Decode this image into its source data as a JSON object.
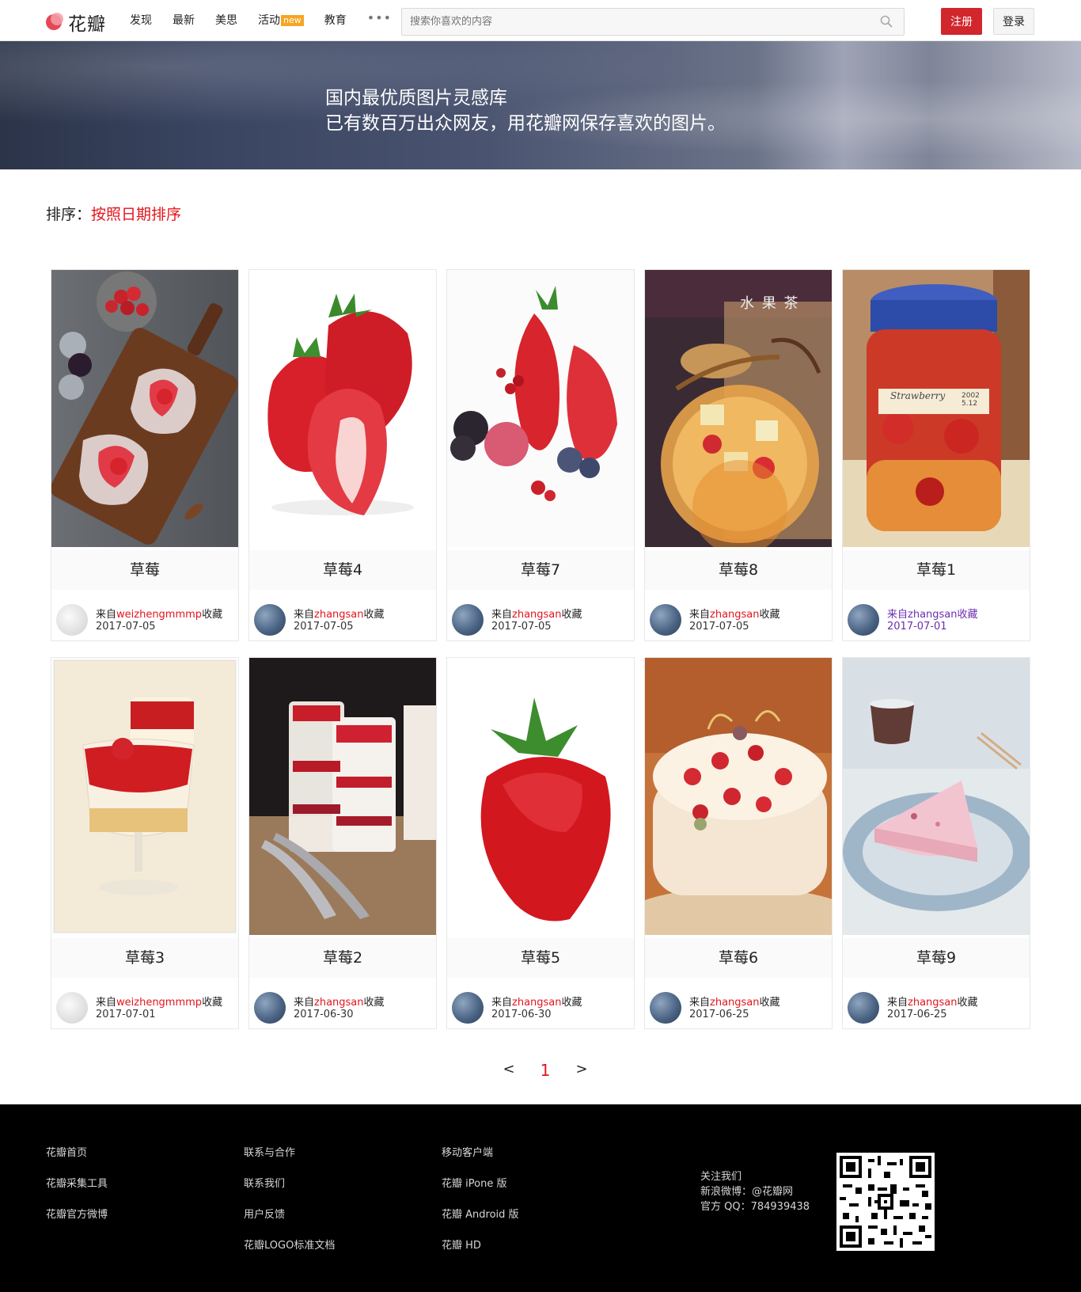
{
  "header": {
    "logo_text": "花瓣",
    "nav": [
      {
        "label": "发现"
      },
      {
        "label": "最新"
      },
      {
        "label": "美思"
      },
      {
        "label": "活动",
        "badge": "new"
      },
      {
        "label": "教育"
      }
    ],
    "more": "•••",
    "search_placeholder": "搜索你喜欢的内容",
    "register": "注册",
    "login": "登录",
    "brand_color": "#d1262c"
  },
  "banner": {
    "line1": "国内最优质图片灵感库",
    "line2": "已有数百万出众网友，用花瓣网保存喜欢的图片。"
  },
  "sort": {
    "label": "排序：",
    "value": "按照日期排序"
  },
  "cards": [
    {
      "title": "草莓",
      "from_prefix": "来自",
      "user": "weizhengmmmp",
      "from_suffix": "收藏",
      "date": "2017-07-05",
      "image": "strawberry-dessert-board"
    },
    {
      "title": "草莓4",
      "from_prefix": "来自",
      "user": "zhangsan",
      "from_suffix": "收藏",
      "date": "2017-07-05",
      "image": "strawberries-halved"
    },
    {
      "title": "草莓7",
      "from_prefix": "来自",
      "user": "zhangsan",
      "from_suffix": "收藏",
      "date": "2017-07-05",
      "image": "mixed-berries"
    },
    {
      "title": "草莓8",
      "from_prefix": "来自",
      "user": "zhangsan",
      "from_suffix": "收藏",
      "date": "2017-07-05",
      "image": "fruit-tea-jar"
    },
    {
      "title": "草莓1",
      "from_prefix": "来自",
      "user": "zhangsan",
      "from_suffix": "收藏",
      "date": "2017-07-01",
      "image": "strawberry-jar"
    },
    {
      "title": "草莓3",
      "from_prefix": "来自",
      "user": "weizhengmmmp",
      "from_suffix": "收藏",
      "date": "2017-07-01",
      "image": "strawberry-panna-cotta"
    },
    {
      "title": "草莓2",
      "from_prefix": "来自",
      "user": "zhangsan",
      "from_suffix": "收藏",
      "date": "2017-06-30",
      "image": "strawberry-parfait"
    },
    {
      "title": "草莓5",
      "from_prefix": "来自",
      "user": "zhangsan",
      "from_suffix": "收藏",
      "date": "2017-06-30",
      "image": "single-strawberry"
    },
    {
      "title": "草莓6",
      "from_prefix": "来自",
      "user": "zhangsan",
      "from_suffix": "收藏",
      "date": "2017-06-25",
      "image": "strawberry-cake"
    },
    {
      "title": "草莓9",
      "from_prefix": "来自",
      "user": "zhangsan",
      "from_suffix": "收藏",
      "date": "2017-06-25",
      "image": "cake-slice-tea"
    }
  ],
  "image_overlays": {
    "fruit_tea": "水 果 茶",
    "jar_label": "Strawberry",
    "jar_date": "2002 5.12"
  },
  "pager": {
    "prev": "<",
    "current": "1",
    "next": ">"
  },
  "footer": {
    "col1": [
      "花瓣首页",
      "花瓣采集工具",
      "花瓣官方微博"
    ],
    "col2": [
      "联系与合作",
      "联系我们",
      "用户反馈",
      "花瓣LOGO标准文档"
    ],
    "col3": [
      "移动客户端",
      "花瓣 iPone 版",
      "花瓣 Android 版",
      "花瓣 HD"
    ],
    "contact": [
      "关注我们",
      "新浪微博：@花瓣网",
      "官方 QQ：784939438"
    ]
  },
  "colors": {
    "accent": "#e3141c",
    "visited": "#6a2fb0",
    "footer_bg": "#000000"
  }
}
